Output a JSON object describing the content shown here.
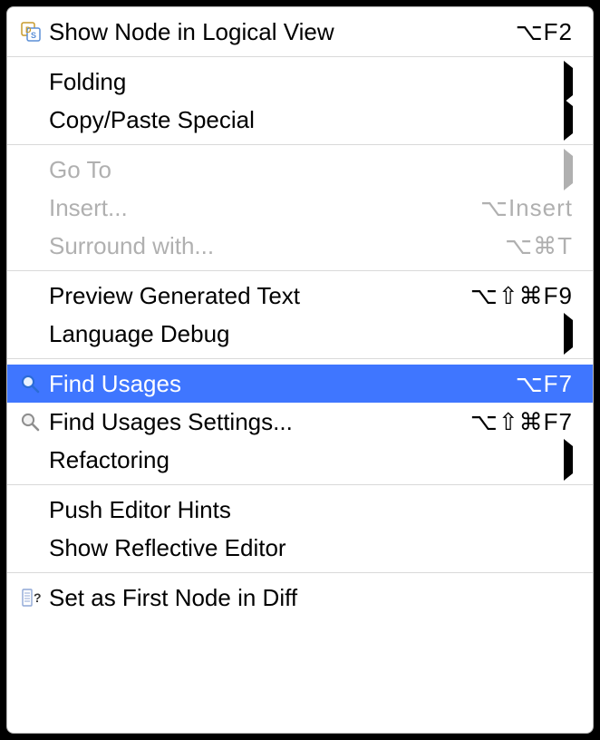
{
  "menu": {
    "items": [
      {
        "label": "Show Node in Logical View",
        "shortcut": "⌥F2",
        "icon": "logical-view",
        "submenu": false,
        "disabled": false
      },
      null,
      {
        "label": "Folding",
        "shortcut": "",
        "icon": null,
        "submenu": true,
        "disabled": false
      },
      {
        "label": "Copy/Paste Special",
        "shortcut": "",
        "icon": null,
        "submenu": true,
        "disabled": false
      },
      null,
      {
        "label": "Go To",
        "shortcut": "",
        "icon": null,
        "submenu": true,
        "disabled": true
      },
      {
        "label": "Insert...",
        "shortcut": "⌥Insert",
        "icon": null,
        "submenu": false,
        "disabled": true
      },
      {
        "label": "Surround with...",
        "shortcut": "⌥⌘T",
        "icon": null,
        "submenu": false,
        "disabled": true
      },
      null,
      {
        "label": "Preview Generated Text",
        "shortcut": "⌥⇧⌘F9",
        "icon": null,
        "submenu": false,
        "disabled": false
      },
      {
        "label": "Language Debug",
        "shortcut": "",
        "icon": null,
        "submenu": true,
        "disabled": false
      },
      null,
      {
        "label": "Find Usages",
        "shortcut": "⌥F7",
        "icon": "search-blue",
        "submenu": false,
        "disabled": false,
        "selected": true
      },
      {
        "label": "Find Usages Settings...",
        "shortcut": "⌥⇧⌘F7",
        "icon": "search-gray",
        "submenu": false,
        "disabled": false
      },
      {
        "label": "Refactoring",
        "shortcut": "",
        "icon": null,
        "submenu": true,
        "disabled": false
      },
      null,
      {
        "label": "Push Editor Hints",
        "shortcut": "",
        "icon": null,
        "submenu": false,
        "disabled": false
      },
      {
        "label": "Show Reflective Editor",
        "shortcut": "",
        "icon": null,
        "submenu": false,
        "disabled": false
      },
      null,
      {
        "label": "Set as First Node in Diff",
        "shortcut": "",
        "icon": "diff",
        "submenu": false,
        "disabled": false
      }
    ]
  }
}
